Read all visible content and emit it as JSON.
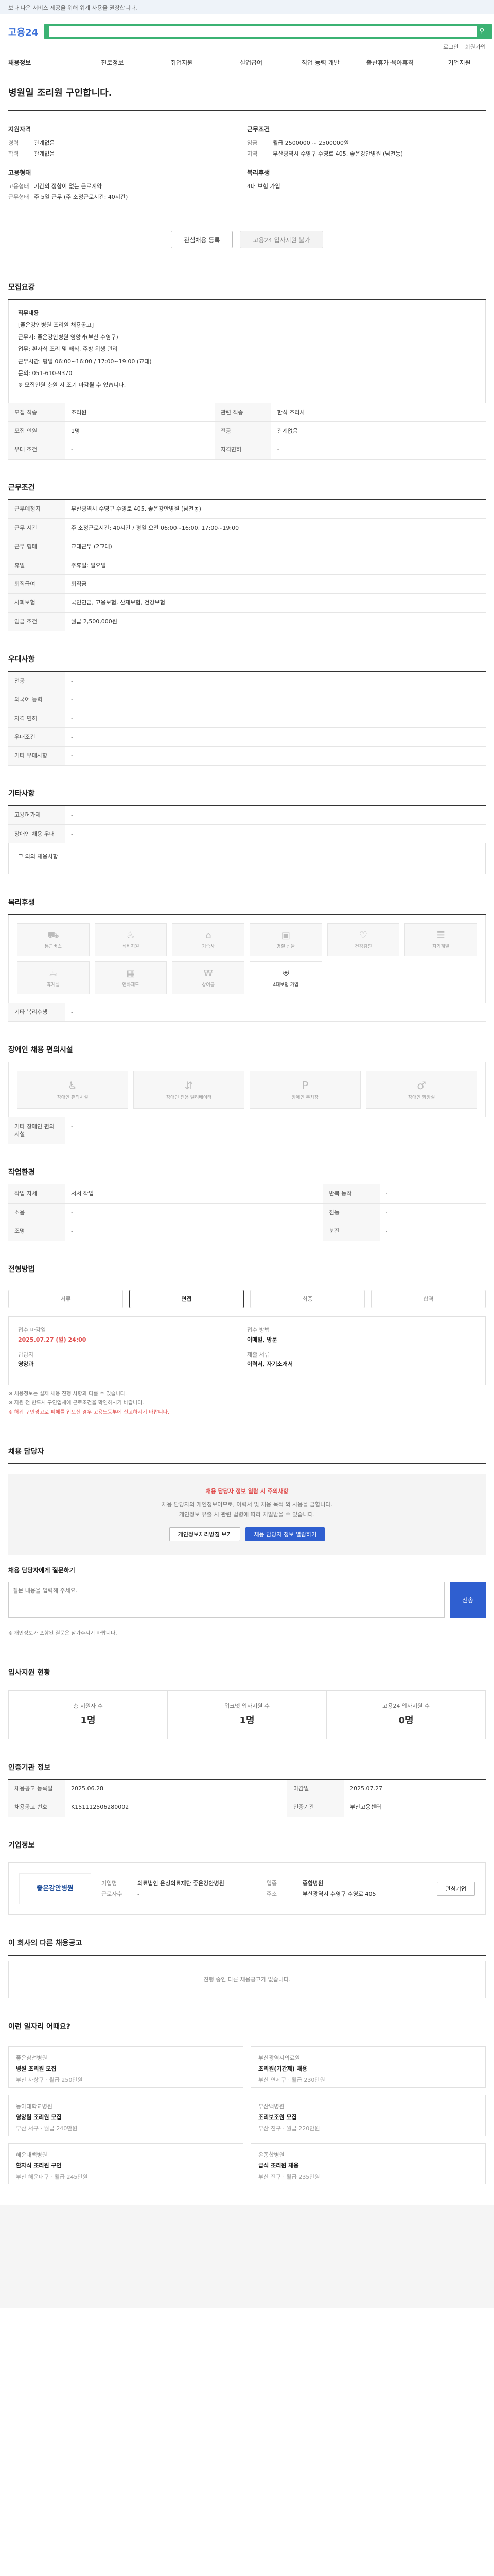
{
  "notice": "보다 나은 서비스 제공을 위해 위계 사용을 권장합니다.",
  "header": {
    "logo": "고용24",
    "search_placeholder": "",
    "util_links": [
      "로그인",
      "회원가입"
    ]
  },
  "gnb": [
    "채용정보",
    "진로정보",
    "취업지원",
    "실업급여",
    "직업 능력 개발",
    "출산휴가·육아휴직",
    "기업지원"
  ],
  "job": {
    "title": "병원일 조리원 구인합니다."
  },
  "summary": {
    "applicant_title": "지원자격",
    "applicant": [
      {
        "k": "경력",
        "v": "관계없음"
      },
      {
        "k": "학력",
        "v": "관계없음"
      }
    ],
    "condition_title": "고용형태",
    "condition": [
      {
        "k": "고용형태",
        "v": "기간의 정함이 없는 근로계약"
      },
      {
        "k": "근무형태",
        "v": "주 5일 근무 (주 소정근로시간: 40시간)"
      }
    ],
    "work_title": "근무조건",
    "work": [
      {
        "k": "임금",
        "v": "월급 2500000 ~ 2500000원"
      },
      {
        "k": "지역",
        "v": "부산광역시 수영구 수영로 405, 좋은강안병원 (남천동)"
      }
    ],
    "welfare_title": "복리후생",
    "welfare_value": "4대 보험 가입"
  },
  "actions": {
    "interest": "관심채용 등록",
    "apply_disabled": "고용24 입사지원 불가"
  },
  "recruit_section": {
    "title": "모집요강",
    "duty_title": "직무내용",
    "duty": [
      "[좋은강안병원 조리원 채용공고]",
      "근무지: 좋은강안병원 영양과(부산 수영구)",
      "업무: 환자식 조리 및 배식, 주방 위생 관리",
      "근무시간: 평일 06:00~16:00 / 17:00~19:00 (교대)",
      "문의: 051-610-9370",
      "※ 모집인원 충원 시 조기 마감될 수 있습니다."
    ],
    "rows": [
      {
        "k": "모집 직종",
        "v": "조리원",
        "k2": "관련 직종",
        "v2": "한식 조리사"
      },
      {
        "k": "모집 인원",
        "v": "1명",
        "k2": "전공",
        "v2": "관계없음"
      },
      {
        "k": "우대 조건",
        "v": "-",
        "k2": "자격면허",
        "v2": "-"
      }
    ]
  },
  "work_section": {
    "title": "근무조건",
    "rows": [
      {
        "k": "근무예정지",
        "v": "부산광역시 수영구 수영로 405, 좋은강안병원 (남천동)"
      },
      {
        "k": "근무 시간",
        "v": "주 소정근로시간: 40시간 / 평일 오전 06:00~16:00, 17:00~19:00"
      },
      {
        "k": "근무 형태",
        "v": "교대근무 (2교대)"
      },
      {
        "k": "휴일",
        "v": "주휴일: 일요일"
      },
      {
        "k": "퇴직급여",
        "v": "퇴직금"
      },
      {
        "k": "사회보험",
        "v": "국민연금, 고용보험, 산재보험, 건강보험"
      },
      {
        "k": "임금 조건",
        "v": "월급 2,500,000원"
      }
    ]
  },
  "prefer_section": {
    "title": "우대사항",
    "rows": [
      {
        "k": "전공",
        "v": "-"
      },
      {
        "k": "외국어 능력",
        "v": "-"
      },
      {
        "k": "자격 면허",
        "v": "-"
      },
      {
        "k": "우대조건",
        "v": "-"
      },
      {
        "k": "기타 우대사항",
        "v": "-"
      }
    ]
  },
  "etc_section": {
    "title": "기타사항",
    "rows": [
      {
        "k": "고용허가제",
        "v": "-"
      },
      {
        "k": "장애인 채용 우대",
        "v": "-"
      }
    ],
    "note": "그 외의 채용사항"
  },
  "welfare_section": {
    "title": "복리후생",
    "items": [
      {
        "icon": "car-icon",
        "label": "통근버스",
        "on": false
      },
      {
        "icon": "meal-icon",
        "label": "식비지원",
        "on": false
      },
      {
        "icon": "home-icon",
        "label": "기숙사",
        "on": false
      },
      {
        "icon": "gift-icon",
        "label": "명절 선물",
        "on": false
      },
      {
        "icon": "heart-icon",
        "label": "건강검진",
        "on": false
      },
      {
        "icon": "book-icon",
        "label": "자기계발",
        "on": false
      },
      {
        "icon": "coffee-icon",
        "label": "휴게실",
        "on": false
      },
      {
        "icon": "calendar-icon",
        "label": "연차제도",
        "on": false
      },
      {
        "icon": "money-icon",
        "label": "상여금",
        "on": false
      },
      {
        "icon": "shield-icon",
        "label": "4대보험 가입",
        "on": true
      }
    ],
    "other_title": "기타 복리후생",
    "other_value": "-"
  },
  "disabled_section": {
    "title": "장애인 채용 편의시설",
    "items": [
      {
        "icon": "wheelchair-icon",
        "label": "장애인 편의시설"
      },
      {
        "icon": "elevator-icon",
        "label": "장애인 전용 엘리베이터"
      },
      {
        "icon": "parking-icon",
        "label": "장애인 주차장"
      },
      {
        "icon": "restroom-icon",
        "label": "장애인 화장실"
      }
    ],
    "other_title": "기타 장애인 편의시설",
    "other_value": "-"
  },
  "env_section": {
    "title": "작업환경",
    "rows": [
      {
        "k": "작업 자세",
        "v": "서서 작업",
        "k2": "반복 동작",
        "v2": "-"
      },
      {
        "k": "소음",
        "v": "-",
        "k2": "진동",
        "v2": "-"
      },
      {
        "k": "조명",
        "v": "-",
        "k2": "분진",
        "v2": "-"
      }
    ]
  },
  "process_section": {
    "title": "전형방법",
    "steps": [
      "서류",
      "면접",
      "최종",
      "합격"
    ]
  },
  "apply_section": {
    "deadline_label": "접수 마감일",
    "deadline": "2025.07.27 (일) 24:00",
    "method_label": "접수 방법",
    "method": "이메일, 방문",
    "contact_label": "담당자",
    "contact": "영양과",
    "docs_label": "제출 서류",
    "docs": "이력서, 자기소개서",
    "notes": [
      "※ 채용정보는 실제 채용 진행 사항과 다를 수 있습니다.",
      "※ 지원 전 반드시 구인업체에 근로조건을 확인하시기 바랍니다.",
      "※ 허위 구인광고로 피해를 입으신 경우 고용노동부에 신고하시기 바랍니다."
    ]
  },
  "consult_section": {
    "title": "채용 담당자",
    "warn": "채용 담당자 정보 열람 시 주의사항",
    "lines": [
      "채용 담당자의 개인정보이므로, 이력서 및 채용 목적 외 사용을 금합니다.",
      "개인정보 유출 시 관련 법령에 따라 처벌받을 수 있습니다."
    ],
    "btn1": "개인정보처리방침 보기",
    "btn2": "채용 담당자 정보 열람하기"
  },
  "inquiry_section": {
    "title": "채용 담당자에게 질문하기",
    "placeholder": "질문 내용을 입력해 주세요.",
    "button": "전송",
    "note": "※ 개인정보가 포함된 질문은 삼가주시기 바랍니다."
  },
  "stats_section": {
    "title": "입사지원 현황",
    "items": [
      {
        "label": "총 지원자 수",
        "value": "1명"
      },
      {
        "label": "워크넷 입사지원 수",
        "value": "1명"
      },
      {
        "label": "고용24 입사지원 수",
        "value": "0명"
      }
    ]
  },
  "posting_section": {
    "title": "인증기관 정보",
    "rows": [
      {
        "k": "채용공고 등록일",
        "v": "2025.06.28",
        "k2": "마감일",
        "v2": "2025.07.27"
      },
      {
        "k": "채용공고 번호",
        "v": "K151112506280002",
        "k2": "인증기관",
        "v2": "부산고용센터"
      }
    ]
  },
  "company_section": {
    "title": "기업정보",
    "logo": "좋은강안병원",
    "info": [
      {
        "k": "기업명",
        "v": "의료법인 은성의료재단 좋은강안병원"
      },
      {
        "k": "업종",
        "v": "종합병원"
      },
      {
        "k": "근로자수",
        "v": "-"
      },
      {
        "k": "주소",
        "v": "부산광역시 수영구 수영로 405"
      }
    ],
    "btn": "관심기업"
  },
  "other_jobs_section": {
    "title": "이 회사의 다른 채용공고",
    "empty": "진행 중인 다른 채용공고가 없습니다."
  },
  "recommend_section": {
    "title": "이런 일자리 어때요?",
    "cards": [
      {
        "company": "좋은삼선병원",
        "title": "병원 조리원 모집",
        "meta": "부산 사상구 · 월급 250만원"
      },
      {
        "company": "부산광역시의료원",
        "title": "조리원(기간제) 채용",
        "meta": "부산 연제구 · 월급 230만원"
      },
      {
        "company": "동아대학교병원",
        "title": "영양팀 조리원 모집",
        "meta": "부산 서구 · 월급 240만원"
      },
      {
        "company": "부산백병원",
        "title": "조리보조원 모집",
        "meta": "부산 진구 · 월급 220만원"
      },
      {
        "company": "해운대백병원",
        "title": "환자식 조리원 구인",
        "meta": "부산 해운대구 · 월급 245만원"
      },
      {
        "company": "온종합병원",
        "title": "급식 조리원 채용",
        "meta": "부산 진구 · 월급 235만원"
      }
    ]
  }
}
